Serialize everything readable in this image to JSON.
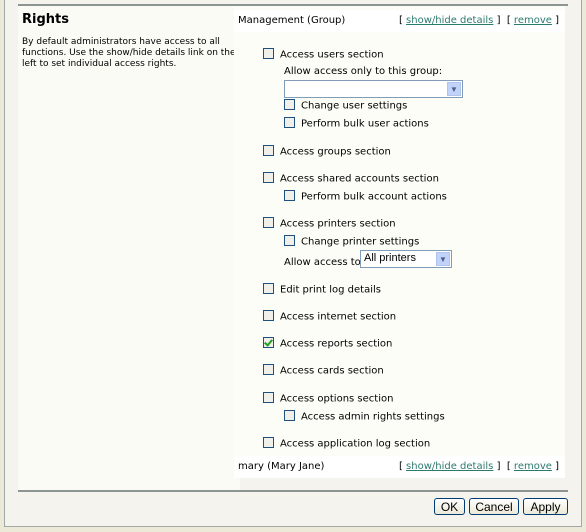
{
  "rights": {
    "title": "Rights",
    "description": "By default administrators have access to all functions. Use the show/hide details link on the left to set individual access rights."
  },
  "entries": [
    {
      "name": "Management (Group)",
      "show_hide": "show/hide details",
      "remove": "remove"
    },
    {
      "name": "mary (Mary Jane)",
      "show_hide": "show/hide details",
      "remove": "remove"
    }
  ],
  "bracket_open": "[",
  "bracket_close": "]",
  "permissions": {
    "users": {
      "label": "Access users section",
      "checked": false
    },
    "group_only_label": "Allow access only to this group:",
    "group_only_value": "",
    "change_user_settings": {
      "label": "Change user settings",
      "checked": false
    },
    "bulk_user_actions": {
      "label": "Perform bulk user actions",
      "checked": false
    },
    "groups": {
      "label": "Access groups section",
      "checked": false
    },
    "shared_accounts": {
      "label": "Access shared accounts section",
      "checked": false
    },
    "bulk_account_actions": {
      "label": "Perform bulk account actions",
      "checked": false
    },
    "printers": {
      "label": "Access printers section",
      "checked": false
    },
    "change_printer_settings": {
      "label": "Change printer settings",
      "checked": false
    },
    "allow_access_to_label": "Allow access to:",
    "allow_access_to_value": "All printers",
    "edit_print_log": {
      "label": "Edit print log details",
      "checked": false
    },
    "internet": {
      "label": "Access internet section",
      "checked": false
    },
    "reports": {
      "label": "Access reports section",
      "checked": true
    },
    "cards": {
      "label": "Access cards section",
      "checked": false
    },
    "options": {
      "label": "Access options section",
      "checked": false
    },
    "admin_rights": {
      "label": "Access admin rights settings",
      "checked": false
    },
    "app_log": {
      "label": "Access application log section",
      "checked": false
    }
  },
  "buttons": {
    "ok": "OK",
    "cancel": "Cancel",
    "apply": "Apply"
  },
  "colors": {
    "link": "#2b7a6e",
    "check": "#21a121"
  }
}
